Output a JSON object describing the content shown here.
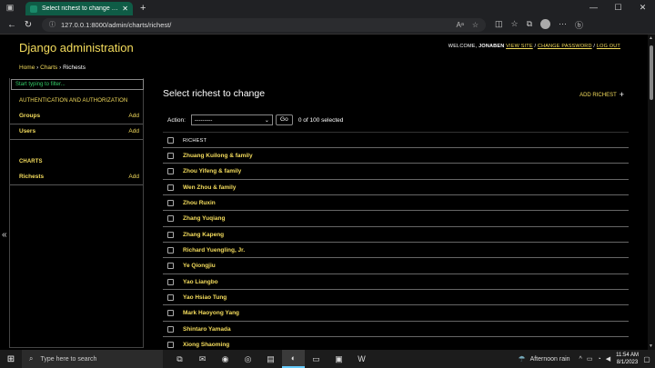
{
  "browser": {
    "tab_title": "Select richest to change | Djang",
    "url": "127.0.0.1:8000/admin/charts/richest/"
  },
  "header": {
    "branding": "Django administration",
    "welcome": "WELCOME,",
    "username": "JONABEN",
    "view_site": "VIEW SITE",
    "change_password": "CHANGE PASSWORD",
    "log_out": "LOG OUT"
  },
  "breadcrumbs": {
    "home": "Home",
    "app": "Charts",
    "current": "Richests"
  },
  "sidebar": {
    "filter_placeholder": "Start typing to filter...",
    "modules": [
      {
        "caption": "AUTHENTICATION AND AUTHORIZATION",
        "models": [
          {
            "name": "Groups",
            "add": "Add"
          },
          {
            "name": "Users",
            "add": "Add"
          }
        ]
      },
      {
        "caption": "CHARTS",
        "models": [
          {
            "name": "Richests",
            "add": "Add"
          }
        ]
      }
    ]
  },
  "main": {
    "title": "Select richest to change",
    "add_button": "ADD RICHEST",
    "action_label": "Action:",
    "action_value": "---------",
    "go_label": "Go",
    "selection_count": "0 of 100 selected",
    "column_header": "RICHEST",
    "rows": [
      "Zhuang Kuilong & family",
      "Zhou Yifeng & family",
      "Wen Zhou & family",
      "Zhou Ruxin",
      "Zhang Yuqiang",
      "Zhang Kapeng",
      "Richard Yuengling, Jr.",
      "Ye Qiongjiu",
      "Yao Liangbo",
      "Yao Hsiao Tung",
      "Mark Haoyong Yang",
      "Shintaro Yamada",
      "Xiong Shaoming"
    ]
  },
  "taskbar": {
    "search_placeholder": "Type here to search",
    "weather": "Afternoon rain",
    "time": "11:54 AM",
    "date": "8/1/2023"
  },
  "colors": {
    "accent": "#f5dd5d",
    "background": "#000000",
    "tab_active": "#0f5c46"
  }
}
